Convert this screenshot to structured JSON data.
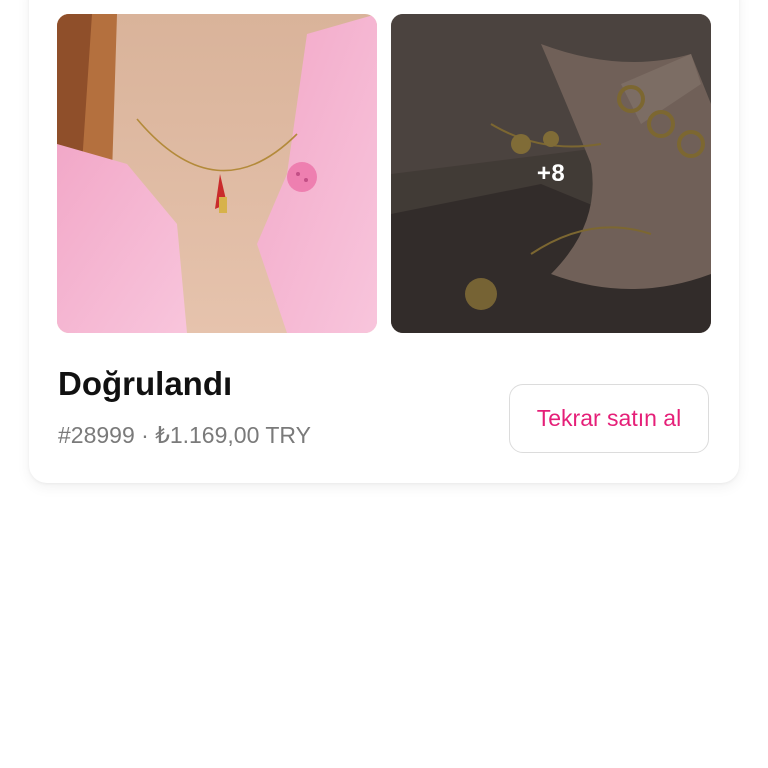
{
  "order": {
    "status": "Doğrulandı",
    "order_number": "#28999",
    "separator": "·",
    "price": "₺1.169,00 TRY",
    "rebuy_label": "Tekrar satın al",
    "extra_images_label": "+8"
  },
  "product_images": [
    {
      "description": "necklace-on-model-pink-cardigan"
    },
    {
      "description": "hand-jewelry-gold-chain"
    }
  ],
  "colors": {
    "accent": "#e51f78",
    "title": "#111111",
    "meta": "#7a7a7a",
    "button_border": "#dcdcdc"
  }
}
